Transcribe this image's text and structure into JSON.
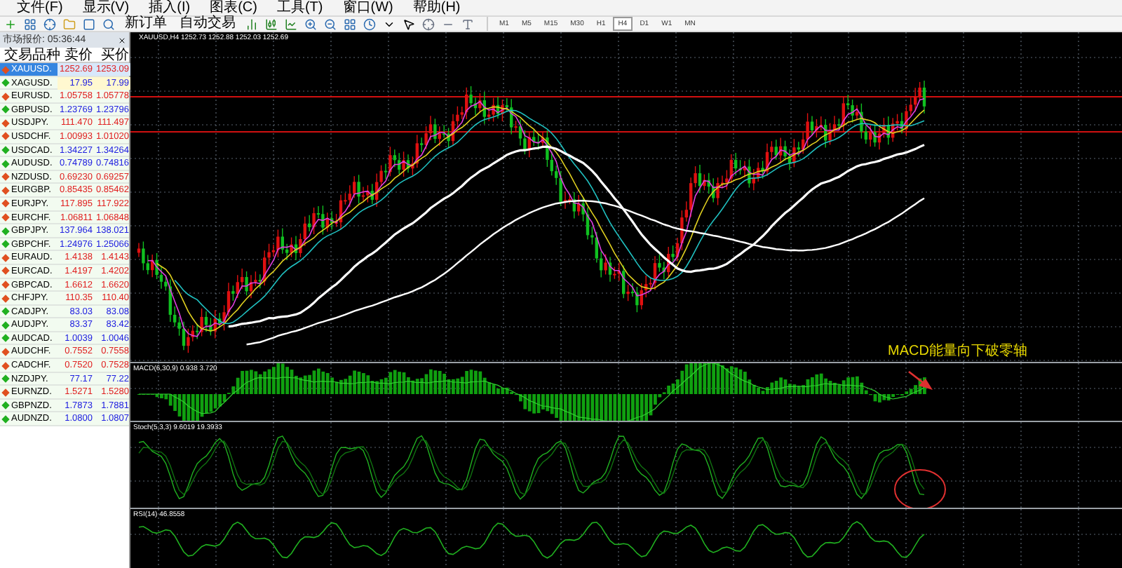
{
  "menu": [
    "文件(F)",
    "显示(V)",
    "插入(I)",
    "图表(C)",
    "工具(T)",
    "窗口(W)",
    "帮助(H)"
  ],
  "toolbar": {
    "buttons": [
      "新订单",
      "自动交易"
    ],
    "timeframes": [
      {
        "label": "M1",
        "selected": false
      },
      {
        "label": "M5",
        "selected": false
      },
      {
        "label": "M15",
        "selected": false
      },
      {
        "label": "M30",
        "selected": false
      },
      {
        "label": "H1",
        "selected": false
      },
      {
        "label": "H4",
        "selected": true
      },
      {
        "label": "D1",
        "selected": false
      },
      {
        "label": "W1",
        "selected": false
      },
      {
        "label": "MN",
        "selected": false
      }
    ]
  },
  "market_watch": {
    "title": "市场报价: 05:36:44",
    "columns": [
      "交易品种",
      "卖价",
      "买价"
    ],
    "rows": [
      {
        "symbol": "XAUUSD.",
        "bid": "1252.69",
        "ask": "1253.09",
        "kind": "down",
        "selected": true,
        "highlighted": false
      },
      {
        "symbol": "XAGUSD.",
        "bid": "17.95",
        "ask": "17.99",
        "kind": "up",
        "selected": false,
        "highlighted": true
      },
      {
        "symbol": "EURUSD.",
        "bid": "1.05758",
        "ask": "1.05778",
        "kind": "down",
        "selected": false,
        "highlighted": false
      },
      {
        "symbol": "GBPUSD.",
        "bid": "1.23769",
        "ask": "1.23796",
        "kind": "up",
        "selected": false,
        "highlighted": false
      },
      {
        "symbol": "USDJPY.",
        "bid": "111.470",
        "ask": "111.497",
        "kind": "down",
        "selected": false,
        "highlighted": false
      },
      {
        "symbol": "USDCHF.",
        "bid": "1.00993",
        "ask": "1.01020",
        "kind": "down",
        "selected": false,
        "highlighted": false
      },
      {
        "symbol": "USDCAD.",
        "bid": "1.34227",
        "ask": "1.34264",
        "kind": "up",
        "selected": false,
        "highlighted": false
      },
      {
        "symbol": "AUDUSD.",
        "bid": "0.74789",
        "ask": "0.74816",
        "kind": "up",
        "selected": false,
        "highlighted": false
      },
      {
        "symbol": "NZDUSD.",
        "bid": "0.69230",
        "ask": "0.69257",
        "kind": "down",
        "selected": false,
        "highlighted": false
      },
      {
        "symbol": "EURGBP.",
        "bid": "0.85435",
        "ask": "0.85462",
        "kind": "down",
        "selected": false,
        "highlighted": false
      },
      {
        "symbol": "EURJPY.",
        "bid": "117.895",
        "ask": "117.922",
        "kind": "down",
        "selected": false,
        "highlighted": false
      },
      {
        "symbol": "EURCHF.",
        "bid": "1.06811",
        "ask": "1.06848",
        "kind": "down",
        "selected": false,
        "highlighted": false
      },
      {
        "symbol": "GBPJPY.",
        "bid": "137.964",
        "ask": "138.021",
        "kind": "up",
        "selected": false,
        "highlighted": false
      },
      {
        "symbol": "GBPCHF.",
        "bid": "1.24976",
        "ask": "1.25066",
        "kind": "up",
        "selected": false,
        "highlighted": false
      },
      {
        "symbol": "EURAUD.",
        "bid": "1.4138",
        "ask": "1.4143",
        "kind": "down",
        "selected": false,
        "highlighted": false
      },
      {
        "symbol": "EURCAD.",
        "bid": "1.4197",
        "ask": "1.4202",
        "kind": "down",
        "selected": false,
        "highlighted": false
      },
      {
        "symbol": "GBPCAD.",
        "bid": "1.6612",
        "ask": "1.6620",
        "kind": "down",
        "selected": false,
        "highlighted": false
      },
      {
        "symbol": "CHFJPY.",
        "bid": "110.35",
        "ask": "110.40",
        "kind": "down",
        "selected": false,
        "highlighted": false
      },
      {
        "symbol": "CADJPY.",
        "bid": "83.03",
        "ask": "83.08",
        "kind": "up",
        "selected": false,
        "highlighted": false
      },
      {
        "symbol": "AUDJPY.",
        "bid": "83.37",
        "ask": "83.42",
        "kind": "up",
        "selected": false,
        "highlighted": false
      },
      {
        "symbol": "AUDCAD.",
        "bid": "1.0039",
        "ask": "1.0046",
        "kind": "up",
        "selected": false,
        "highlighted": false
      },
      {
        "symbol": "AUDCHF.",
        "bid": "0.7552",
        "ask": "0.7558",
        "kind": "down",
        "selected": false,
        "highlighted": false
      },
      {
        "symbol": "CADCHF.",
        "bid": "0.7520",
        "ask": "0.7528",
        "kind": "down",
        "selected": false,
        "highlighted": false
      },
      {
        "symbol": "NZDJPY.",
        "bid": "77.17",
        "ask": "77.22",
        "kind": "up",
        "selected": false,
        "highlighted": false
      },
      {
        "symbol": "EURNZD.",
        "bid": "1.5271",
        "ask": "1.5280",
        "kind": "down",
        "selected": false,
        "highlighted": false
      },
      {
        "symbol": "GBPNZD.",
        "bid": "1.7873",
        "ask": "1.7881",
        "kind": "up",
        "selected": false,
        "highlighted": false
      },
      {
        "symbol": "AUDNZD.",
        "bid": "1.0800",
        "ask": "1.0807",
        "kind": "up",
        "selected": false,
        "highlighted": false
      }
    ]
  },
  "chart": {
    "title": "XAUUSD,H4  1252.73 1252.88 1252.03 1252.69",
    "annotation": "MACD能量向下破零轴"
  },
  "indicators": [
    {
      "kind": "macd",
      "label": "MACD(6,30,9) 0.938 3.720"
    },
    {
      "kind": "stoch",
      "label": "Stoch(5,3,3) 9.6019 19.3933"
    },
    {
      "kind": "rsi",
      "label": "RSI(14) 46.8558"
    }
  ]
}
